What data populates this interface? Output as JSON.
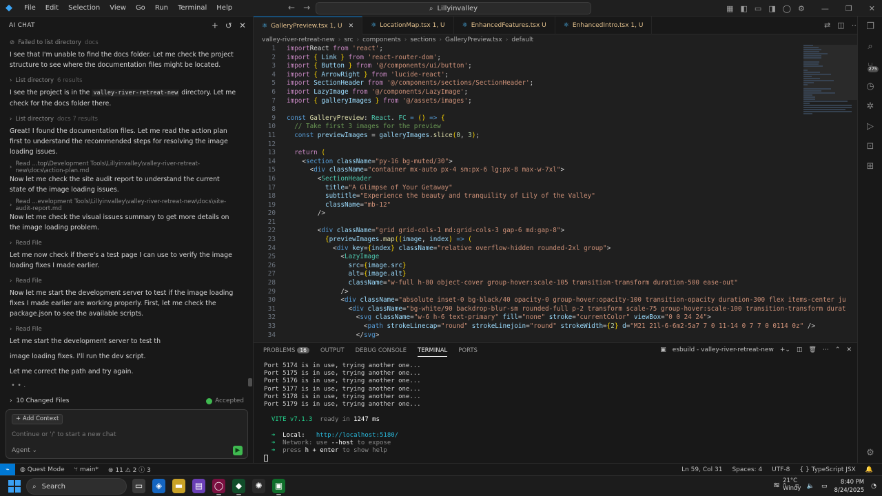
{
  "menu": [
    "File",
    "Edit",
    "Selection",
    "View",
    "Go",
    "Run",
    "Terminal",
    "Help"
  ],
  "command_center": "Lillyinvalley",
  "chat": {
    "header": "AI CHAT",
    "items": [
      {
        "kind": "tool",
        "label": "Failed to list directory",
        "meta": "docs"
      },
      {
        "kind": "msg",
        "text": "I see that I'm unable to find the docs folder. Let me check the project structure to see where the documentation files might be located."
      },
      {
        "kind": "tool",
        "label": "List directory",
        "meta": "6 results"
      },
      {
        "kind": "msg",
        "pre": "I see the project is in the ",
        "code": "valley-river-retreat-new",
        "post": " directory. Let me check for the docs folder there."
      },
      {
        "kind": "tool",
        "label": "List directory",
        "meta": "docs  7 results"
      },
      {
        "kind": "msg",
        "text": "Great! I found the documentation files. Let me read the action plan first to understand the recommended steps for resolving the image loading issues."
      },
      {
        "kind": "tool",
        "label": "Read  ...top\\Development Tools\\Lillyinvalley\\valley-river-retreat-new\\docs\\action-plan.md",
        "meta": ""
      },
      {
        "kind": "msg",
        "text": "Now let me check the site audit report to understand the current state of the image loading issues."
      },
      {
        "kind": "tool",
        "label": "Read  ...evelopment Tools\\Lillyinvalley\\valley-river-retreat-new\\docs\\site-audit-report.md",
        "meta": ""
      },
      {
        "kind": "msg",
        "text": "Now let me check the visual issues summary to get more details on the image loading problem."
      },
      {
        "kind": "tool",
        "label": "Read File",
        "meta": ""
      },
      {
        "kind": "msg",
        "text": "Let me now check if there's a test page I can use to verify the image loading fixes I made earlier."
      },
      {
        "kind": "tool",
        "label": "Read File",
        "meta": ""
      },
      {
        "kind": "msg",
        "text": "Now let me start the development server to test if the image loading fixes I made earlier are working properly. First, let me check the package.json to see the available scripts."
      },
      {
        "kind": "tool",
        "label": "Read File",
        "meta": ""
      },
      {
        "kind": "msg",
        "text": "Let me start the development server to test th"
      },
      {
        "kind": "msg",
        "text": "image loading fixes. I'll run the dev script."
      },
      {
        "kind": "msg",
        "text": "Let me correct the path and try again."
      },
      {
        "kind": "dots",
        "text": "• • ."
      }
    ],
    "changed_files": "10 Changed Files",
    "accepted": "Accepted",
    "add_context": "+ Add Context",
    "input_placeholder": "Continue or '/' to start a new chat",
    "agent": "Agent"
  },
  "tabs": [
    {
      "label": "GalleryPreview.tsx 1, U",
      "active": true
    },
    {
      "label": "LocationMap.tsx 1, U",
      "active": false
    },
    {
      "label": "EnhancedFeatures.tsx U",
      "active": false
    },
    {
      "label": "EnhancedIntro.tsx 1, U",
      "active": false
    }
  ],
  "breadcrumb": [
    "valley-river-retreat-new",
    "src",
    "components",
    "sections",
    "GalleryPreview.tsx",
    "default"
  ],
  "code": [
    [
      [
        "kw",
        "import"
      ],
      [
        "",
        "React "
      ],
      [
        "kw",
        "from"
      ],
      [
        "str",
        " 'react'"
      ],
      [
        "",
        ";"
      ]
    ],
    [
      [
        "kw",
        "import"
      ],
      [
        "",
        ""
      ],
      [
        "br",
        " {"
      ],
      [
        "var",
        " Link "
      ],
      [
        "br",
        "}"
      ],
      [
        "kw",
        " from"
      ],
      [
        "str",
        " 'react-router-dom'"
      ],
      [
        "",
        ";"
      ]
    ],
    [
      [
        "kw",
        "import"
      ],
      [
        "br",
        " {"
      ],
      [
        "var",
        " Button "
      ],
      [
        "br",
        "}"
      ],
      [
        "kw",
        " from"
      ],
      [
        "str",
        " '@/components/ui/button'"
      ],
      [
        "",
        ";"
      ]
    ],
    [
      [
        "kw",
        "import"
      ],
      [
        "br",
        " {"
      ],
      [
        "var",
        " ArrowRight "
      ],
      [
        "br",
        "}"
      ],
      [
        "kw",
        " from"
      ],
      [
        "str",
        " 'lucide-react'"
      ],
      [
        "",
        ";"
      ]
    ],
    [
      [
        "kw",
        "import"
      ],
      [
        "var",
        " SectionHeader "
      ],
      [
        "kw",
        "from"
      ],
      [
        "str",
        " '@/components/sections/SectionHeader'"
      ],
      [
        "",
        ";"
      ]
    ],
    [
      [
        "kw",
        "import"
      ],
      [
        "var",
        " LazyImage "
      ],
      [
        "kw",
        "from"
      ],
      [
        "str",
        " '@/components/LazyImage'"
      ],
      [
        "",
        ";"
      ]
    ],
    [
      [
        "kw",
        "import"
      ],
      [
        "br",
        " {"
      ],
      [
        "var",
        " galleryImages "
      ],
      [
        "br",
        "}"
      ],
      [
        "kw",
        " from"
      ],
      [
        "str",
        " '@/assets/images'"
      ],
      [
        "",
        ";"
      ]
    ],
    [],
    [
      [
        "kw2",
        "const"
      ],
      [
        "fn",
        " GalleryPreview"
      ],
      [
        "",
        ": "
      ],
      [
        "tag",
        "React"
      ],
      [
        "",
        ". "
      ],
      [
        "tag",
        "FC"
      ],
      [
        "",
        ""
      ],
      [
        "kw2",
        " ="
      ],
      [
        "br",
        " ()"
      ],
      [
        "kw2",
        " =>"
      ],
      [
        "br",
        " {"
      ]
    ],
    [
      [
        "cm",
        "  // Take first 3 images for the preview"
      ]
    ],
    [
      [
        "kw2",
        "  const"
      ],
      [
        "var",
        " previewImages"
      ],
      [
        "",
        " = "
      ],
      [
        "var",
        "galleryImages"
      ],
      [
        "",
        "."
      ],
      [
        "fn",
        "slice"
      ],
      [
        "br",
        "("
      ],
      [
        "num",
        "0"
      ],
      [
        "",
        ", "
      ],
      [
        "num",
        "3"
      ],
      [
        "br",
        ")"
      ],
      [
        "",
        ";"
      ]
    ],
    [],
    [
      [
        "kw",
        "  return"
      ],
      [
        "br",
        " ("
      ]
    ],
    [
      [
        "",
        "    <"
      ],
      [
        "kw2",
        "section"
      ],
      [
        "var",
        " className"
      ],
      [
        "",
        "="
      ],
      [
        "str",
        "\"py-16 bg-muted/30\""
      ],
      [
        "",
        ">"
      ]
    ],
    [
      [
        "",
        "      <"
      ],
      [
        "kw2",
        "div"
      ],
      [
        "var",
        " className"
      ],
      [
        "",
        "="
      ],
      [
        "str",
        "\"container mx-auto px-4 sm:px-6 lg:px-8 max-w-7xl\""
      ],
      [
        "",
        ">"
      ]
    ],
    [
      [
        "",
        "        <"
      ],
      [
        "tag",
        "SectionHeader"
      ]
    ],
    [
      [
        "var",
        "          title"
      ],
      [
        "",
        "="
      ],
      [
        "str",
        "\"A Glimpse of Your Getaway\""
      ]
    ],
    [
      [
        "var",
        "          subtitle"
      ],
      [
        "",
        "="
      ],
      [
        "str",
        "\"Experience the beauty and tranquility of Lily of the Valley\""
      ]
    ],
    [
      [
        "var",
        "          className"
      ],
      [
        "",
        "="
      ],
      [
        "str",
        "\"mb-12\""
      ]
    ],
    [
      [
        "",
        "        />"
      ]
    ],
    [],
    [
      [
        "",
        "        <"
      ],
      [
        "kw2",
        "div"
      ],
      [
        "var",
        " className"
      ],
      [
        "",
        "="
      ],
      [
        "str",
        "\"grid grid-cols-1 md:grid-cols-3 gap-6 md:gap-8\""
      ],
      [
        "",
        ">"
      ]
    ],
    [
      [
        "br",
        "          {"
      ],
      [
        "var",
        "previewImages"
      ],
      [
        "",
        "."
      ],
      [
        "fn",
        "map"
      ],
      [
        "br",
        "(("
      ],
      [
        "var",
        "image"
      ],
      [
        "",
        ", "
      ],
      [
        "var",
        "index"
      ],
      [
        "br",
        ")"
      ],
      [
        "kw2",
        " =>"
      ],
      [
        "br",
        " ("
      ]
    ],
    [
      [
        "",
        "            <"
      ],
      [
        "kw2",
        "div"
      ],
      [
        "var",
        " key"
      ],
      [
        "",
        "="
      ],
      [
        "br",
        "{"
      ],
      [
        "var",
        "index"
      ],
      [
        "br",
        "}"
      ],
      [
        "var",
        " className"
      ],
      [
        "",
        "="
      ],
      [
        "str",
        "\"relative overflow-hidden rounded-2xl group\""
      ],
      [
        "",
        ">"
      ]
    ],
    [
      [
        "",
        "              <"
      ],
      [
        "tag",
        "LazyImage"
      ]
    ],
    [
      [
        "var",
        "                src"
      ],
      [
        "",
        "="
      ],
      [
        "br",
        "{"
      ],
      [
        "var",
        "image"
      ],
      [
        "",
        "."
      ],
      [
        "var",
        "src"
      ],
      [
        "br",
        "}"
      ]
    ],
    [
      [
        "var",
        "                alt"
      ],
      [
        "",
        "="
      ],
      [
        "br",
        "{"
      ],
      [
        "var",
        "image"
      ],
      [
        "",
        "."
      ],
      [
        "var",
        "alt"
      ],
      [
        "br",
        "}"
      ]
    ],
    [
      [
        "var",
        "                className"
      ],
      [
        "",
        "="
      ],
      [
        "str",
        "\"w-full h-80 object-cover group-hover:scale-105 transition-transform duration-500 ease-out\""
      ]
    ],
    [
      [
        "",
        "              />"
      ]
    ],
    [
      [
        "",
        "              <"
      ],
      [
        "kw2",
        "div"
      ],
      [
        "var",
        " className"
      ],
      [
        "",
        "="
      ],
      [
        "str",
        "\"absolute inset-0 bg-black/40 opacity-0 group-hover:opacity-100 transition-opacity duration-300 flex items-center ju"
      ]
    ],
    [
      [
        "",
        "                <"
      ],
      [
        "kw2",
        "div"
      ],
      [
        "var",
        " className"
      ],
      [
        "",
        "="
      ],
      [
        "str",
        "\"bg-white/90 backdrop-blur-sm rounded-full p-2 transform scale-75 group-hover:scale-100 transition-transform durat"
      ]
    ],
    [
      [
        "",
        "                  <"
      ],
      [
        "kw2",
        "svg"
      ],
      [
        "var",
        " className"
      ],
      [
        "",
        "="
      ],
      [
        "str",
        "\"w-6 h-6 text-primary\""
      ],
      [
        "var",
        " fill"
      ],
      [
        "",
        "="
      ],
      [
        "str",
        "\"none\""
      ],
      [
        "var",
        " stroke"
      ],
      [
        "",
        "="
      ],
      [
        "str",
        "\"currentColor\""
      ],
      [
        "var",
        " viewBox"
      ],
      [
        "",
        "="
      ],
      [
        "str",
        "\"0 0 24 24\""
      ],
      [
        "",
        ">"
      ]
    ],
    [
      [
        "",
        "                    <"
      ],
      [
        "kw2",
        "path"
      ],
      [
        "var",
        " strokeLinecap"
      ],
      [
        "",
        "="
      ],
      [
        "str",
        "\"round\""
      ],
      [
        "var",
        " strokeLinejoin"
      ],
      [
        "",
        "="
      ],
      [
        "str",
        "\"round\""
      ],
      [
        "var",
        " strokeWidth"
      ],
      [
        "",
        "="
      ],
      [
        "br",
        "{"
      ],
      [
        "num",
        "2"
      ],
      [
        "br",
        "}"
      ],
      [
        "var",
        " d"
      ],
      [
        "",
        "="
      ],
      [
        "str",
        "\"M21 21l-6-6m2-5a7 7 0 11-14 0 7 7 0 0114 0z\""
      ],
      [
        "",
        " />"
      ]
    ],
    [
      [
        "",
        "                  </"
      ],
      [
        "kw2",
        "svg"
      ],
      [
        "",
        ">"
      ]
    ]
  ],
  "panel": {
    "tabs": [
      "PROBLEMS",
      "OUTPUT",
      "DEBUG CONSOLE",
      "TERMINAL",
      "PORTS"
    ],
    "problems_count": "16",
    "active_tab": "TERMINAL",
    "terminal_name": "esbuild - valley-river-retreat-new",
    "lines": [
      "Port 5174 is in use, trying another one...",
      "Port 5175 is in use, trying another one...",
      "Port 5176 is in use, trying another one...",
      "Port 5177 is in use, trying another one...",
      "Port 5178 is in use, trying another one...",
      "Port 5179 is in use, trying another one..."
    ],
    "vite_name": "VITE v7.1.3",
    "vite_ready": "ready in",
    "vite_time": "1247 ms",
    "local_label": "Local:",
    "local_url": "http://localhost:5180/",
    "network_label": "Network: use",
    "network_flag": "--host",
    "network_rest": "to expose",
    "help_pre": "press",
    "help_key": "h + enter",
    "help_post": "to show help"
  },
  "status": {
    "mode": "Quest Mode",
    "branch": "main*",
    "errors": "11",
    "warnings": "2",
    "info": "3",
    "position": "Ln 59, Col 31",
    "spaces": "Spaces: 4",
    "encoding": "UTF-8",
    "language": "TypeScript JSX"
  },
  "activity_badge": "275",
  "taskbar": {
    "search": "Search",
    "temperature": "21°C",
    "weather": "Windy",
    "time": "8:40 PM",
    "date": "8/24/2025"
  }
}
